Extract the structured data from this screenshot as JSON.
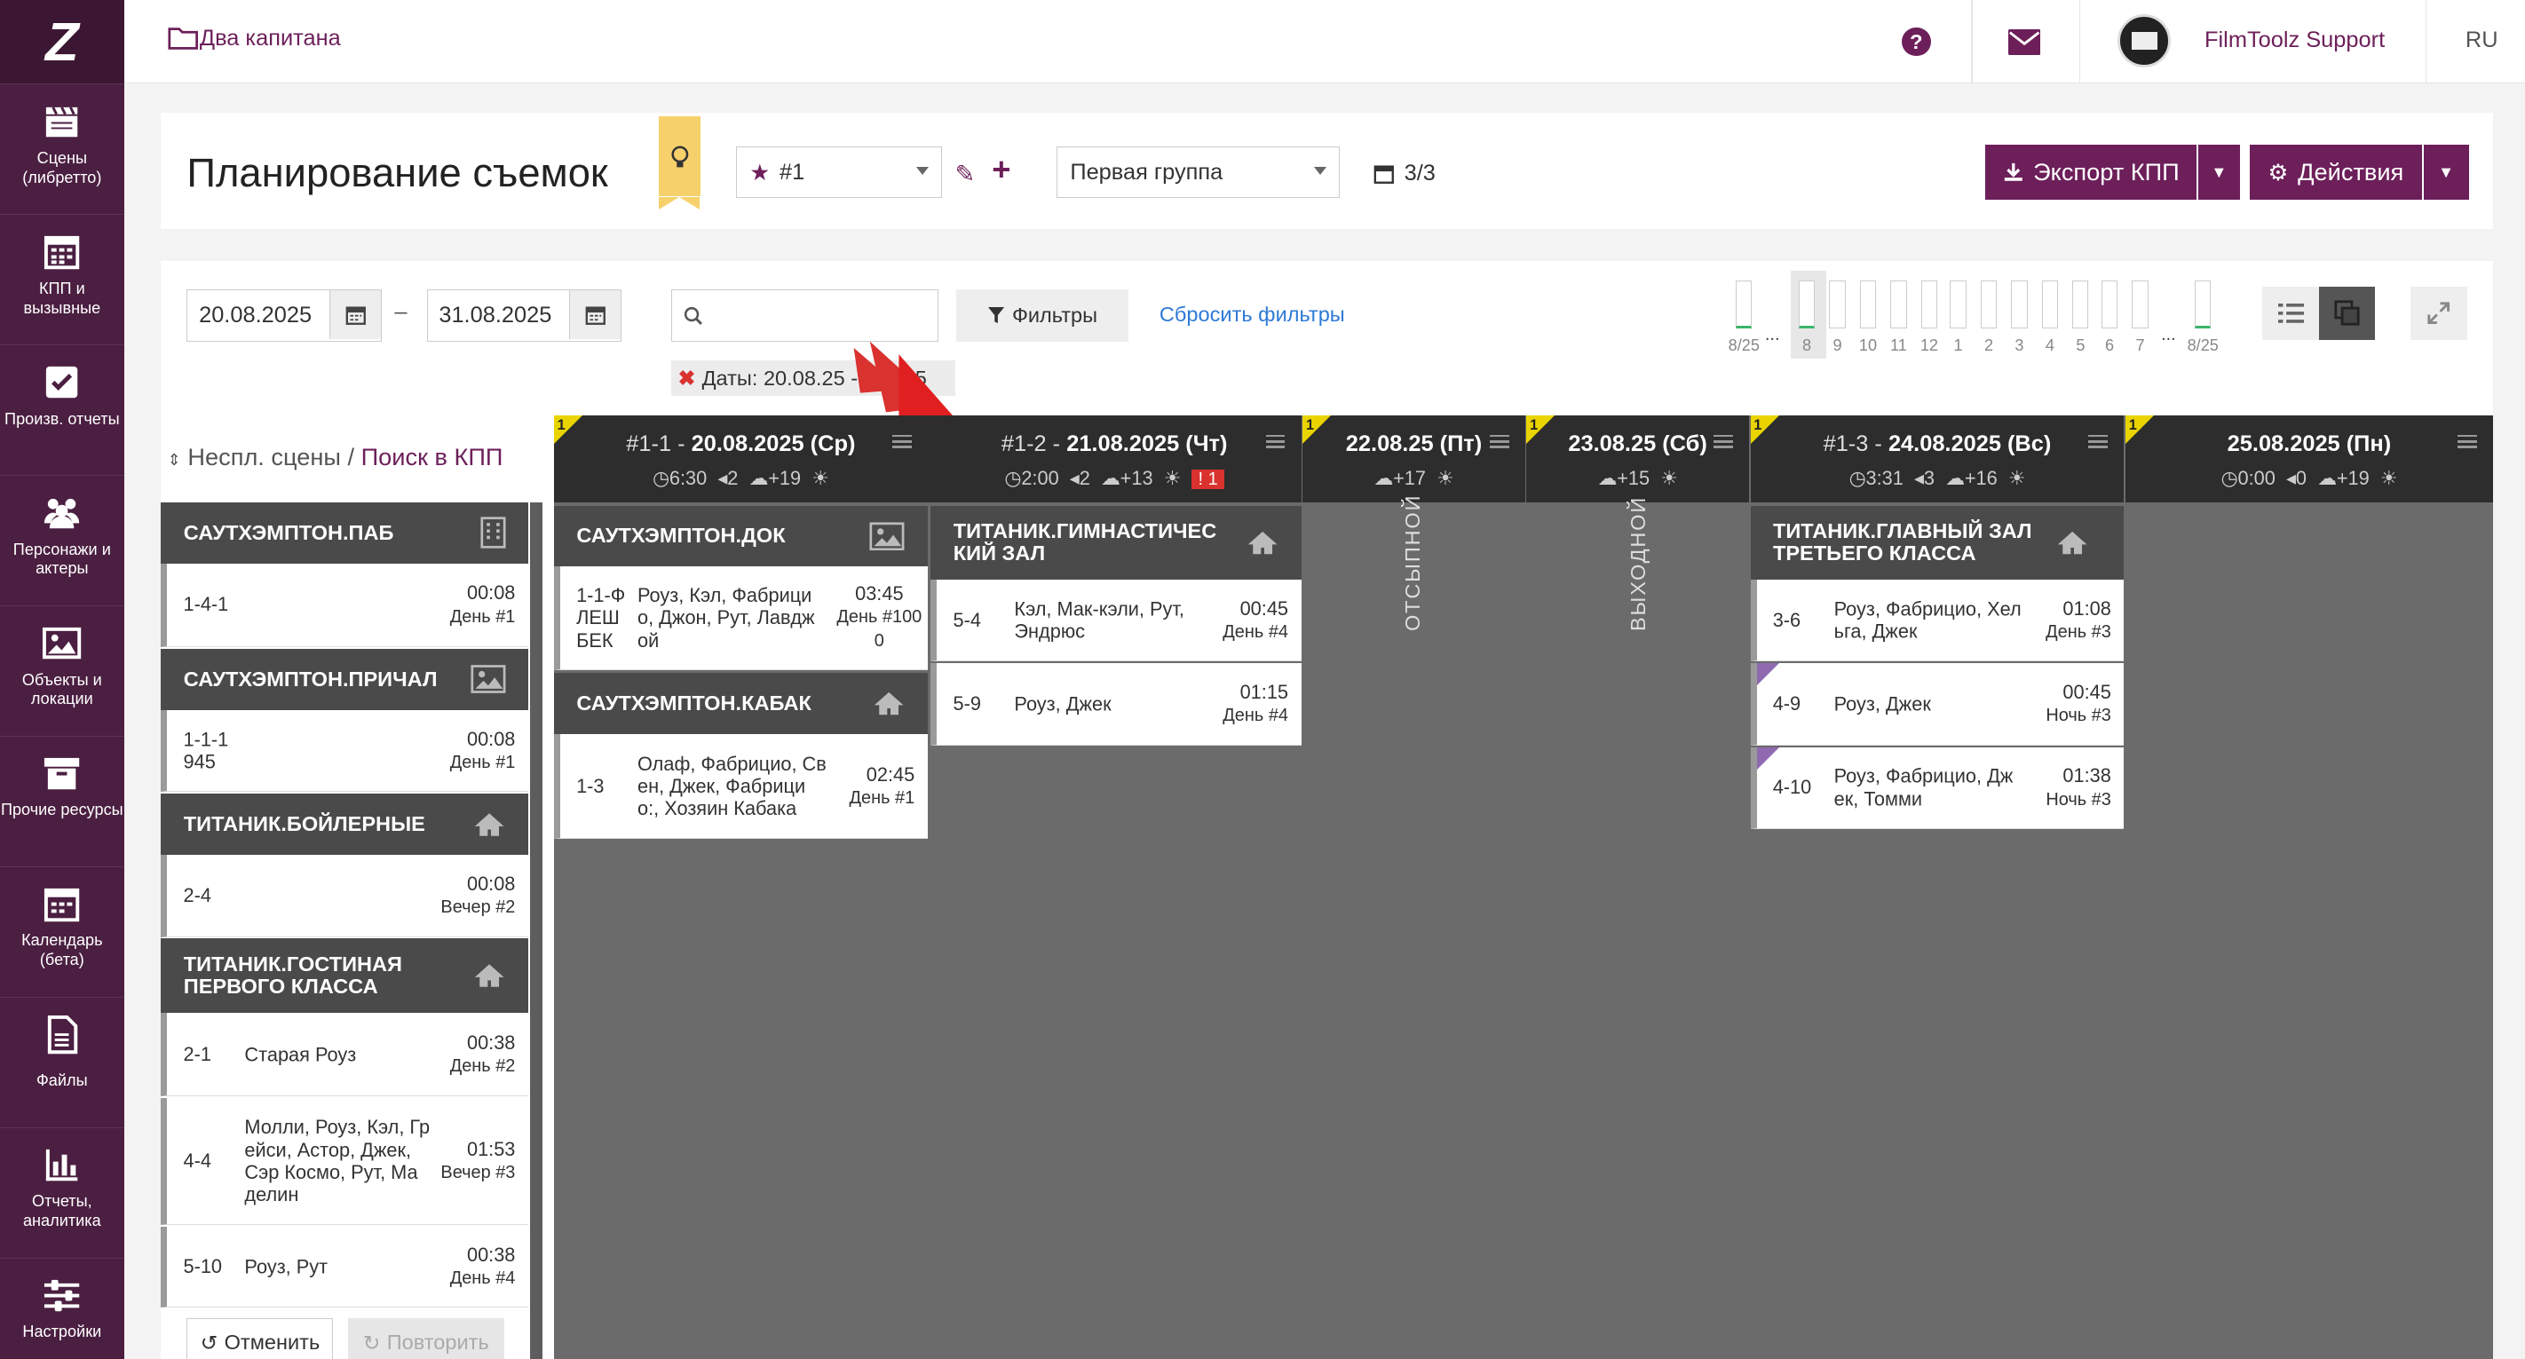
{
  "app": {
    "logo": "Z",
    "project": "Два капитана",
    "user": "FilmToolz Support",
    "lang": "RU"
  },
  "sidebar": [
    {
      "label": "Сцены (либретто)",
      "icon": "clapperboard-icon"
    },
    {
      "label": "КПП и вызывные",
      "icon": "calendar-grid-icon"
    },
    {
      "label": "Произв. отчеты",
      "icon": "checkbox-icon"
    },
    {
      "label": "Персонажи и актеры",
      "icon": "people-icon"
    },
    {
      "label": "Объекты и локации",
      "icon": "image-icon"
    },
    {
      "label": "Прочие ресурсы",
      "icon": "archive-icon"
    },
    {
      "label": "Календарь (бета)",
      "icon": "calendar-icon"
    },
    {
      "label": "Файлы",
      "icon": "file-icon"
    },
    {
      "label": "Отчеты, аналитика",
      "icon": "bar-chart-icon"
    },
    {
      "label": "Настройки",
      "icon": "sliders-icon"
    }
  ],
  "header": {
    "title": "Планирование съемок",
    "version": "#1",
    "group": "Первая группа",
    "count": "3/3",
    "export": "Экспорт КПП",
    "actions": "Действия"
  },
  "filters": {
    "date_from": "20.08.2025",
    "date_dash": "–",
    "date_to": "31.08.2025",
    "search_placeholder": "",
    "filters_btn": "Фильтры",
    "reset": "Сбросить фильтры",
    "chip": "Даты: 20.08.25 - 31.08.25",
    "chip_visible": "Даты:  20.08.25 - 3",
    "chip_tail": ".25"
  },
  "timeline": {
    "left": "8/25",
    "dots": "...",
    "days": [
      "8",
      "9",
      "10",
      "11",
      "12",
      "1",
      "2",
      "3",
      "4",
      "5",
      "6",
      "7"
    ],
    "right": "8/25",
    "dots2": "..."
  },
  "left_panel": {
    "title_gray": "Неспл. сцены /",
    "title_link": "Поиск в КПП",
    "undo": "Отменить",
    "redo": "Повторить",
    "groups": [
      {
        "name": "САУТХЭМПТОН.ПАБ",
        "rows": [
          {
            "num": "1-4-1",
            "chars": "",
            "time": "00:08",
            "day": "День #1"
          }
        ]
      },
      {
        "name": "САУТХЭМПТОН.ПРИЧАЛ",
        "rows": [
          {
            "num": "1-1-1 945",
            "chars": "",
            "time": "00:08",
            "day": "День #1"
          }
        ]
      },
      {
        "name": "ТИТАНИК.БОЙЛЕРНЫЕ",
        "rows": [
          {
            "num": "2-4",
            "chars": "",
            "time": "00:08",
            "day": "Вечер #2"
          }
        ]
      },
      {
        "name": "ТИТАНИК.ГОСТИНАЯ ПЕРВОГО КЛАССА",
        "rows": [
          {
            "num": "2-1",
            "chars": "Старая Роуз",
            "time": "00:38",
            "day": "День #2"
          },
          {
            "num": "4-4",
            "chars": "Молли, Роуз, Кэл, Гр ейси, Астор, Джек, Сэр Космо, Рут, Ма делин",
            "time": "01:53",
            "day": "Вечер #3"
          },
          {
            "num": "5-10",
            "chars": "Роуз, Рут",
            "time": "00:38",
            "day": "День #4"
          }
        ]
      }
    ]
  },
  "days": [
    {
      "flag": "1",
      "id": "#1-1 -",
      "date": "20.08.2025 (Ср)",
      "time": "6:30",
      "pages": "2",
      "weather": "+19",
      "alert": "",
      "groups": [
        {
          "name": "САУТХЭМПТОН.ДОК",
          "rows": [
            {
              "num": "1-1-Ф ЛЕШ БЕК",
              "chars": "Роуз, Кэл, Фабрици о, Джон, Рут, Лавдж ой",
              "time": "03:45",
              "day": "День #100 0"
            }
          ]
        },
        {
          "name": "САУТХЭМПТОН.КАБАК",
          "rows": [
            {
              "num": "1-3",
              "chars": "Олаф, Фабрицио, Св ен, Джек, Фабрици о:, Хозяин Кабака",
              "time": "02:45",
              "day": "День #1"
            }
          ]
        }
      ]
    },
    {
      "flag": "",
      "id": "#1-2 -",
      "date": "21.08.2025 (Чт)",
      "time": "2:00",
      "pages": "2",
      "weather": "+13",
      "alert": "1",
      "groups": [
        {
          "name": "ТИТАНИК.ГИМНАСТИЧЕС КИЙ ЗАЛ",
          "rows": [
            {
              "num": "5-4",
              "chars": "Кэл, Мак-кэли, Рут, Эндрюс",
              "time": "00:45",
              "day": "День #4"
            },
            {
              "num": "5-9",
              "chars": "Роуз, Джек",
              "time": "01:15",
              "day": "День #4"
            }
          ]
        }
      ]
    },
    {
      "flag": "1",
      "id": "",
      "date": "22.08.25 (Пт)",
      "weather": "+17",
      "vertical": "ОТСЫПНОЙ"
    },
    {
      "flag": "1",
      "id": "",
      "date": "23.08.25 (Сб)",
      "weather": "+15",
      "vertical": "ВЫХОДНОЙ"
    },
    {
      "flag": "1",
      "id": "#1-3 -",
      "date": "24.08.2025 (Вс)",
      "time": "3:31",
      "pages": "3",
      "weather": "+16",
      "alert": "",
      "groups": [
        {
          "name": "ТИТАНИК.ГЛАВНЫЙ ЗАЛ ТРЕТЬЕГО КЛАССА",
          "rows": [
            {
              "num": "3-6",
              "chars": "Роуз, Фабрицио, Хел ьга, Джек",
              "time": "01:08",
              "day": "День #3"
            },
            {
              "num": "4-9",
              "chars": "Роуз, Джек",
              "time": "00:45",
              "day": "Ночь #3"
            },
            {
              "num": "4-10",
              "chars": "Роуз, Фабрицио, Дж ек, Томми",
              "time": "01:38",
              "day": "Ночь #3"
            }
          ]
        }
      ]
    },
    {
      "flag": "1",
      "id": "",
      "date": "25.08.2025 (Пн)",
      "time": "0:00",
      "pages": "0",
      "weather": "+19",
      "alert": ""
    }
  ],
  "colors": {
    "brand": "#6d1f5a",
    "sidebar": "#4b1f41",
    "link": "#2d7ad6",
    "dark": "#2d2d2d",
    "group": "#4a4a4a"
  }
}
